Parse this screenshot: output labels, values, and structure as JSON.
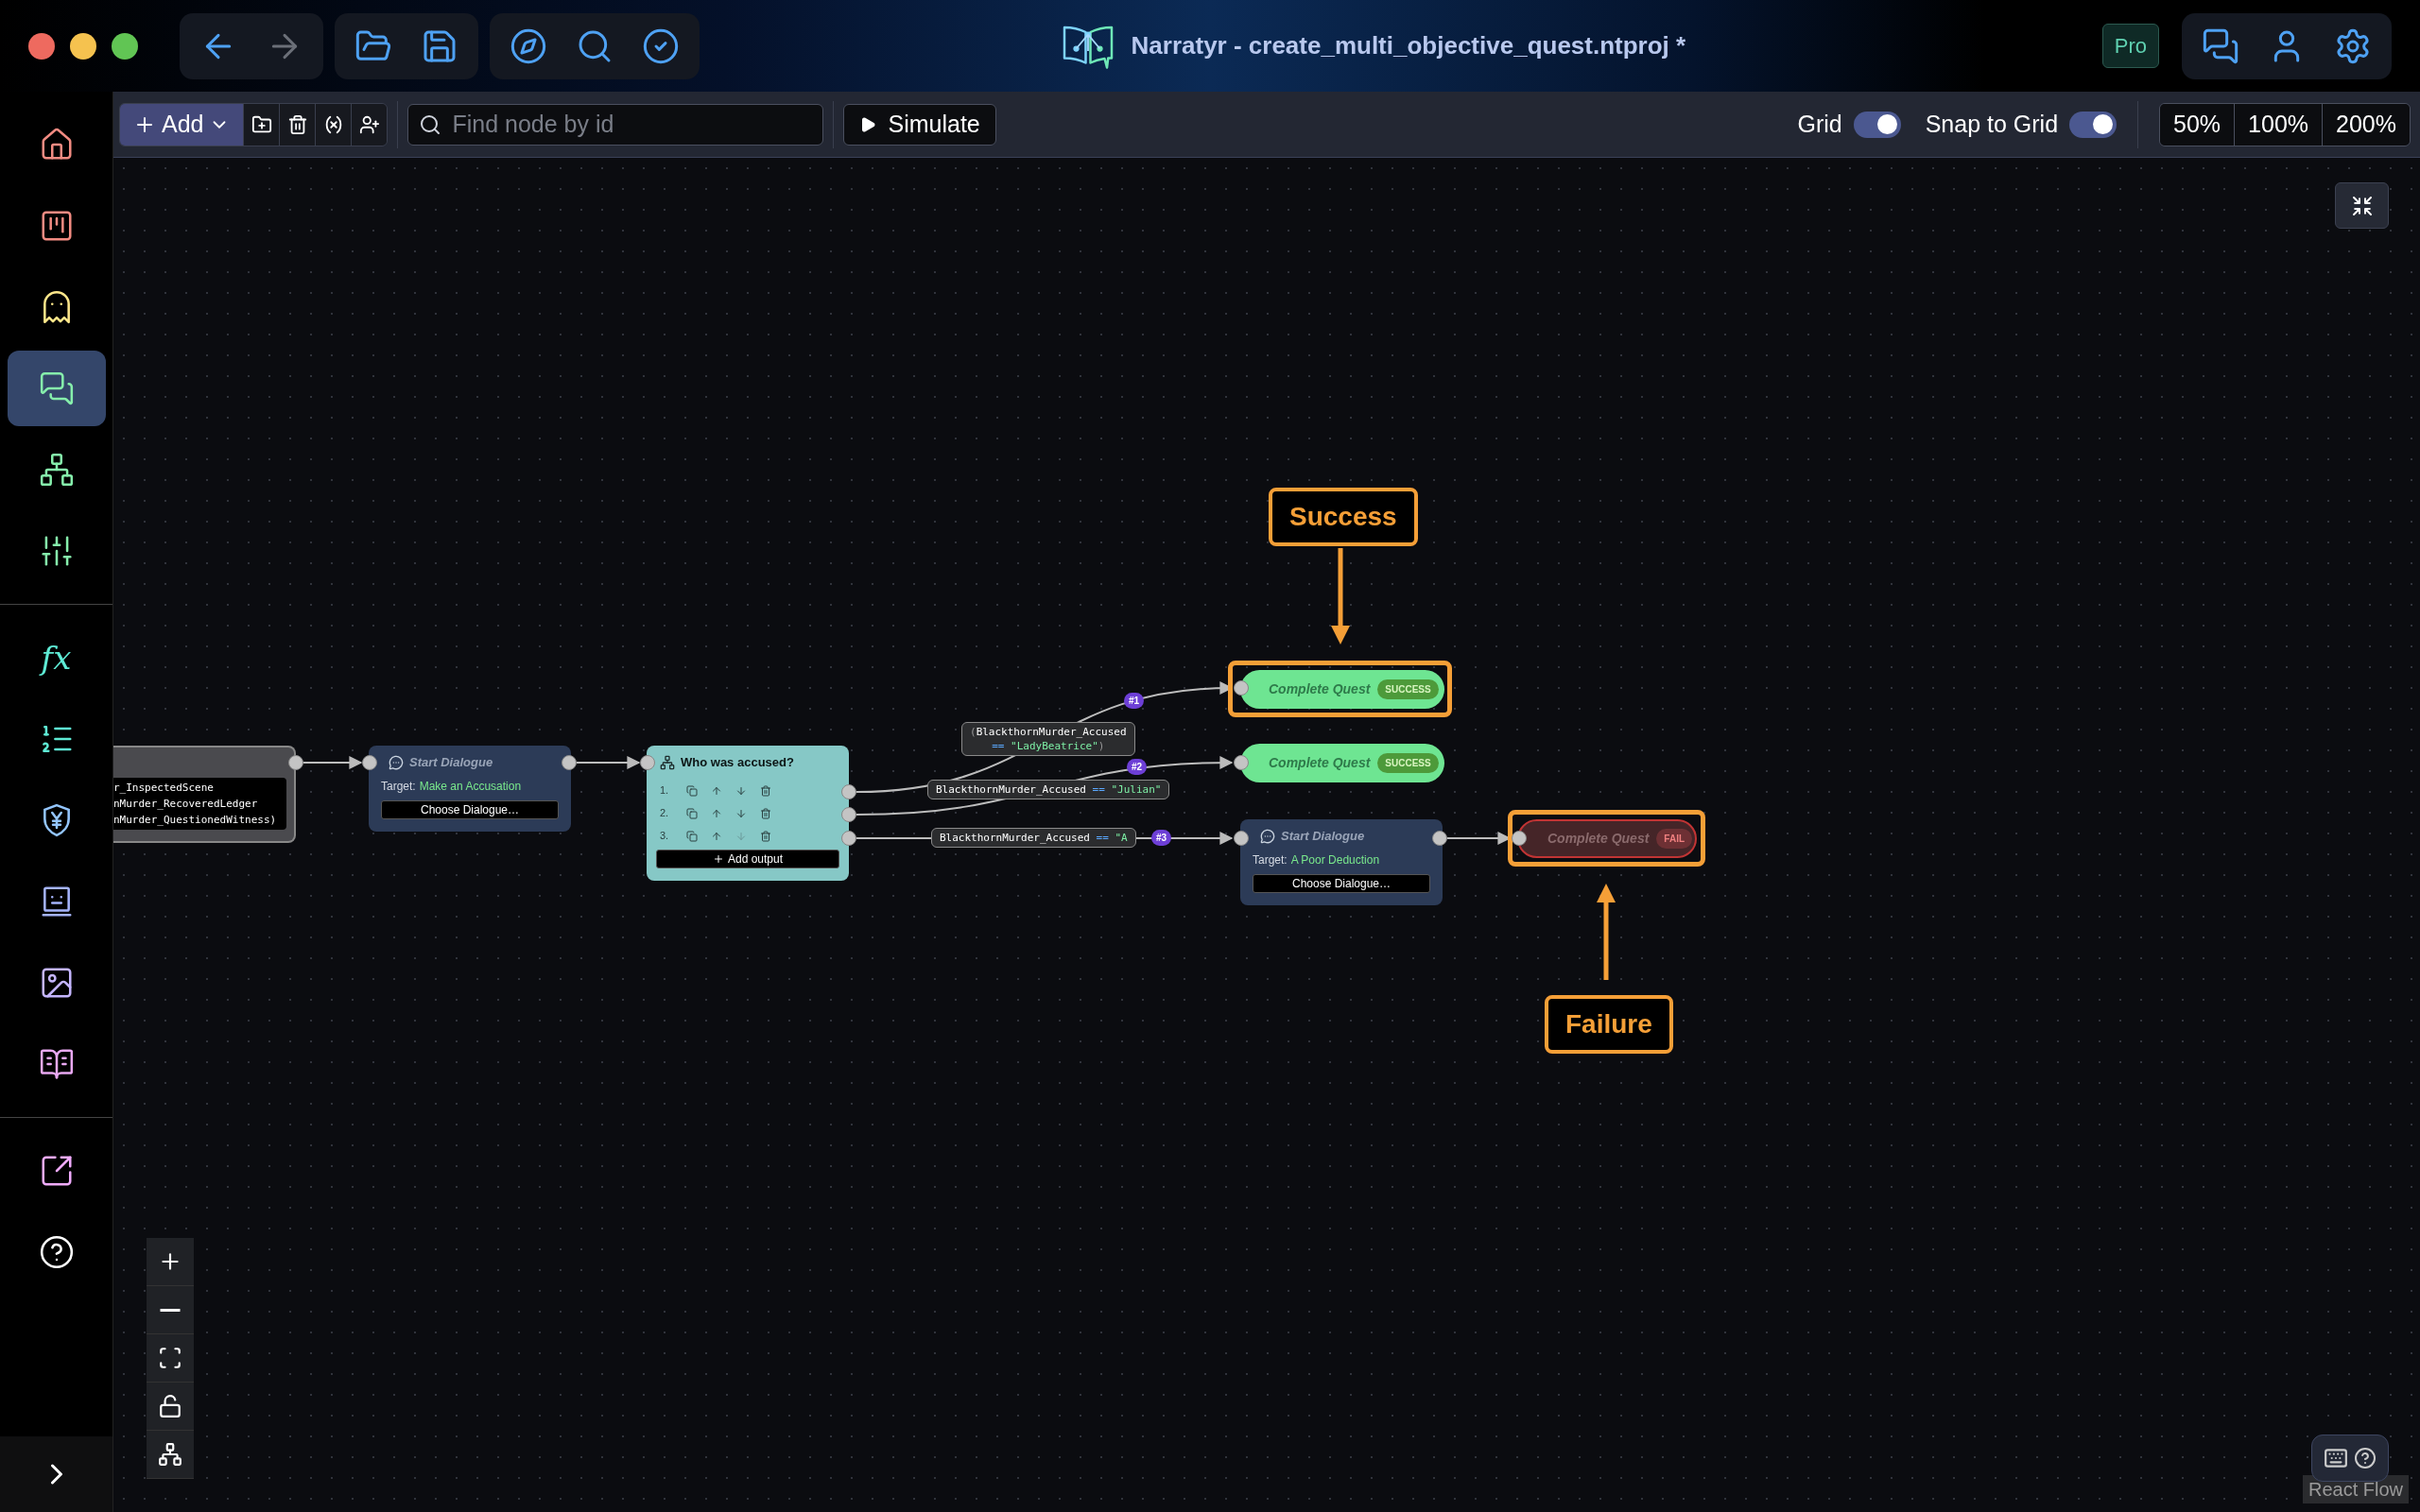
{
  "window": {
    "title": "Narratyr - create_multi_objective_quest.ntproj *",
    "badge": "Pro"
  },
  "sidebar": {
    "groups": [
      [
        {
          "selected": false
        },
        {
          "selected": false
        },
        {
          "selected": false
        },
        {
          "selected": true
        },
        {
          "selected": false
        },
        {
          "selected": false
        }
      ],
      [
        {
          "selected": false,
          "glyph": "fx"
        },
        {
          "selected": false
        },
        {
          "selected": false
        },
        {
          "selected": false
        },
        {
          "selected": false
        },
        {
          "selected": false
        }
      ],
      [
        {
          "selected": false
        },
        {
          "selected": false
        }
      ]
    ]
  },
  "toolbar": {
    "add": "Add",
    "search": {
      "placeholder": "Find node by id"
    },
    "simulate": "Simulate",
    "grid": {
      "label": "Grid",
      "on": true
    },
    "snap": {
      "label": "Snap to Grid",
      "on": true
    },
    "zooms": [
      "50%",
      "100%",
      "200%"
    ]
  },
  "canvas": {
    "nodes": [
      {
        "kind": "conditions",
        "lines": [
          "r_InspectedScene",
          "nMurder_RecoveredLedger",
          "nMurder_QuestionedWitness)"
        ]
      },
      {
        "kind": "dialogue",
        "title": "Start Dialogue",
        "target_label": "Target:",
        "target": "Make an Accusation",
        "button": "Choose Dialogue…"
      },
      {
        "kind": "branch",
        "title": "Who was accused?",
        "outputs": [
          {
            "index": "1.",
            "move_down_disabled": false
          },
          {
            "index": "2.",
            "move_down_disabled": false
          },
          {
            "index": "3.",
            "move_down_disabled": true
          }
        ],
        "add_output": "Add output"
      },
      {
        "kind": "success_end",
        "title": "Complete Quest",
        "badge": "SUCCESS",
        "highlighted": true
      },
      {
        "kind": "success_end",
        "title": "Complete Quest",
        "badge": "SUCCESS",
        "highlighted": false
      },
      {
        "kind": "dialogue",
        "title": "Start Dialogue",
        "target_label": "Target:",
        "target": "A Poor Deduction",
        "button": "Choose Dialogue…"
      },
      {
        "kind": "fail_end",
        "title": "Complete Quest",
        "badge": "FAIL",
        "highlighted": true
      }
    ],
    "edges": [
      {
        "badge": "#1",
        "open": "(",
        "left": "BlackthornMurder_Accused",
        "op": "==",
        "right": "\"LadyBeatrice\"",
        "close": ")"
      },
      {
        "badge": "#2",
        "left": "BlackthornMurder_Accused",
        "op": "==",
        "right": "\"Julian\""
      },
      {
        "badge": "#3",
        "left": "BlackthornMurder_Accused",
        "op": "==",
        "right": "\"A"
      }
    ],
    "callouts": [
      "Success",
      "Failure"
    ],
    "attribution": "React Flow"
  }
}
